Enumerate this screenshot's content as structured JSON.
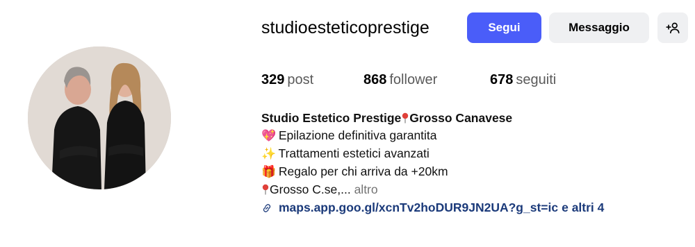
{
  "profile": {
    "username": "studioesteticoprestige",
    "avatar_icon": "profile-photo"
  },
  "actions": {
    "follow_label": "Segui",
    "message_label": "Messaggio",
    "suggest_icon": "add-person-icon"
  },
  "stats": [
    {
      "value": "329",
      "label": "post"
    },
    {
      "value": "868",
      "label": "follower"
    },
    {
      "value": "678",
      "label": "seguiti"
    }
  ],
  "bio": {
    "name_part1": "Studio Estetico Prestige",
    "name_part2": "Grosso Canavese",
    "lines": [
      {
        "emoji": "💖",
        "text": "Epilazione definitiva garantita"
      },
      {
        "emoji": "✨",
        "text": "Trattamenti estetici avanzati"
      },
      {
        "emoji": "🎁",
        "text": "Regalo per chi arriva da +20km"
      }
    ],
    "location_text": "Grosso C.se,...",
    "more_label": "altro",
    "link_text": "maps.app.goo.gl/xcnTv2hoDUR9JN2UA?g_st=ic",
    "link_extra": "e altri 4"
  },
  "colors": {
    "follow_button": "#4a5df9",
    "secondary_button": "#eff0f2",
    "link": "#1b3a7a",
    "muted": "#737373"
  }
}
